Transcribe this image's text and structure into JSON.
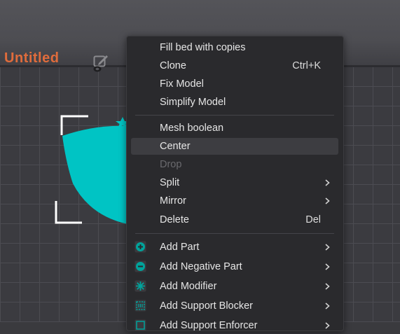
{
  "project": {
    "title": "Untitled"
  },
  "menu": {
    "items": [
      {
        "label": "Fill bed with copies",
        "shortcut": ""
      },
      {
        "label": "Clone",
        "shortcut": "Ctrl+K"
      },
      {
        "label": "Fix Model",
        "shortcut": ""
      },
      {
        "label": "Simplify Model",
        "shortcut": ""
      },
      {
        "label": "Mesh boolean",
        "shortcut": ""
      },
      {
        "label": "Center",
        "shortcut": "",
        "hovered": true
      },
      {
        "label": "Drop",
        "shortcut": "",
        "disabled": true
      },
      {
        "label": "Split",
        "submenu": true
      },
      {
        "label": "Mirror",
        "submenu": true
      },
      {
        "label": "Delete",
        "shortcut": "Del"
      },
      {
        "label": "Add Part",
        "icon": "add-part-icon",
        "submenu": true
      },
      {
        "label": "Add Negative Part",
        "icon": "add-negative-part-icon",
        "submenu": true
      },
      {
        "label": "Add Modifier",
        "icon": "add-modifier-icon",
        "submenu": true
      },
      {
        "label": "Add Support Blocker",
        "icon": "add-support-blocker-icon",
        "submenu": true
      },
      {
        "label": "Add Support Enforcer",
        "icon": "add-support-enforcer-icon",
        "submenu": true
      }
    ]
  },
  "colors": {
    "accent": "#00c4c4",
    "title": "#e06c3c",
    "menu_bg": "#2a2a2d"
  }
}
